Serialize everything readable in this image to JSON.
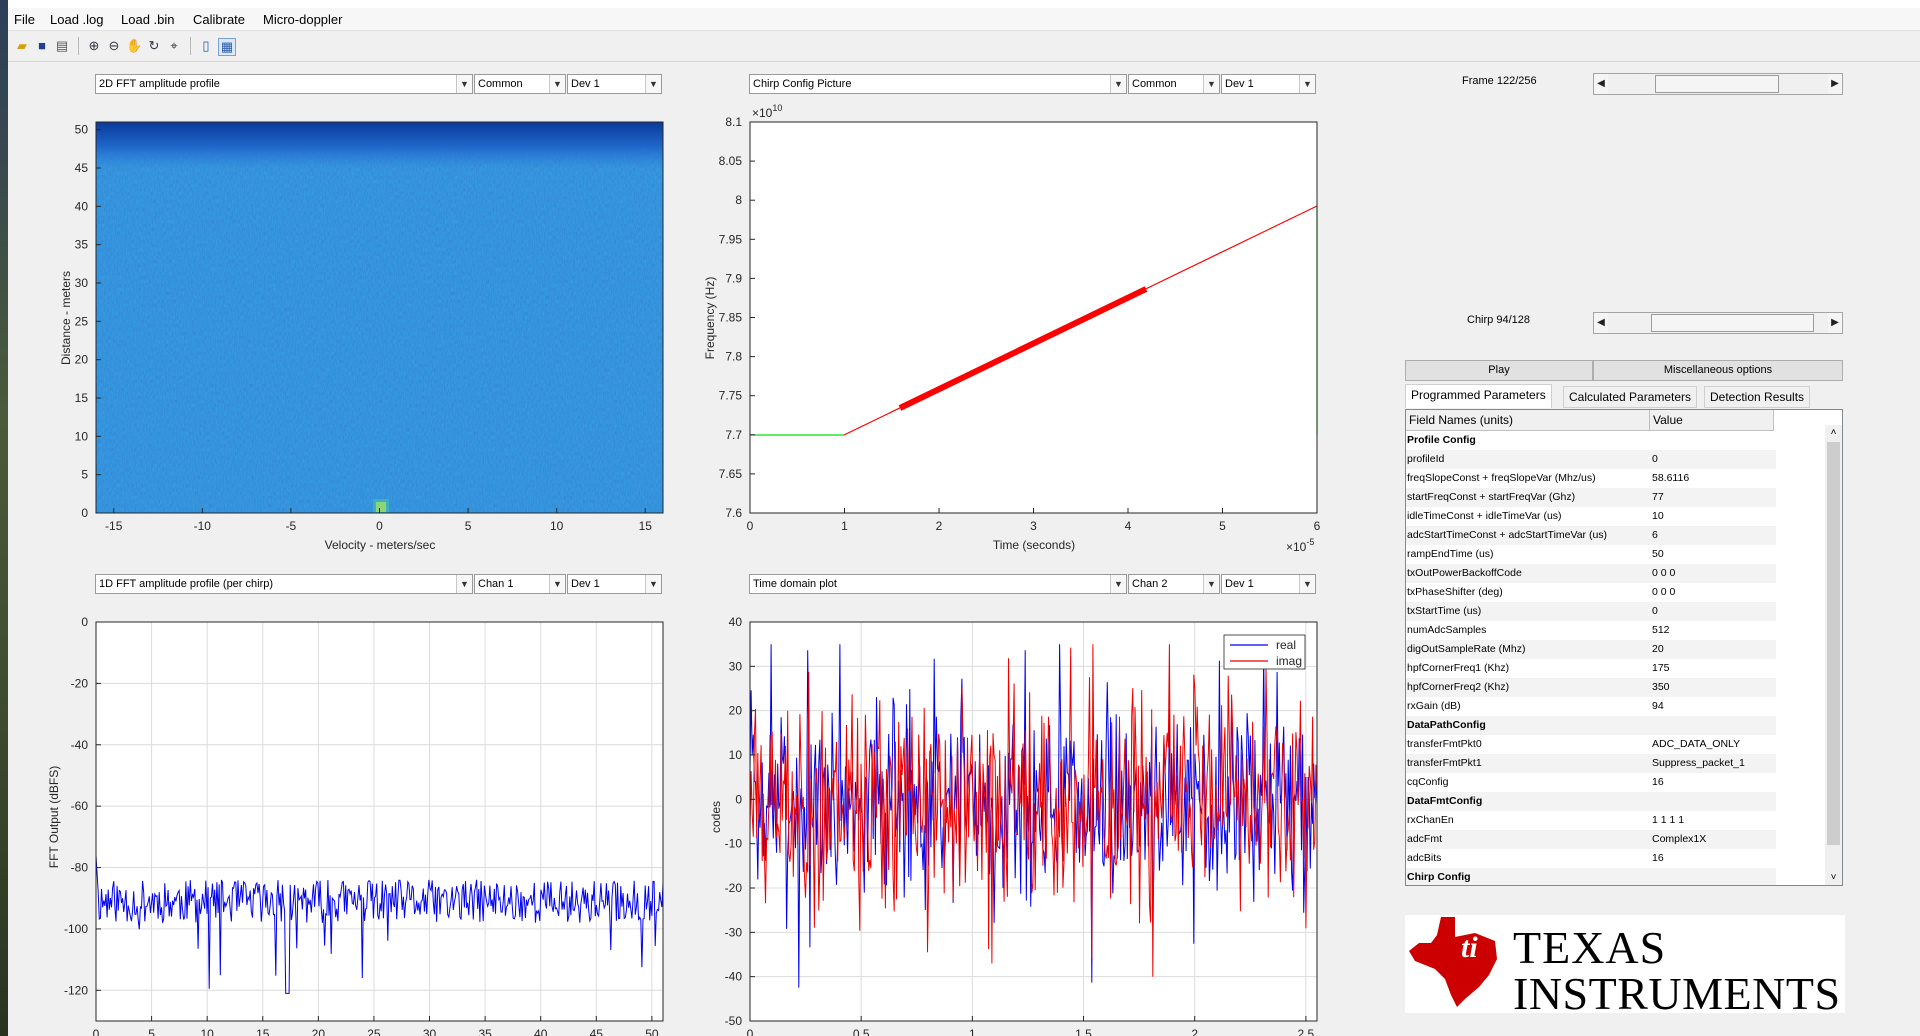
{
  "menu": [
    "File",
    "Load .log",
    "Load .bin",
    "Calibrate",
    "Micro-doppler"
  ],
  "toolbar_icons": [
    "open-folder-icon",
    "save-icon",
    "print-icon",
    "zoom-in-icon",
    "zoom-out-icon",
    "pan-hand-icon",
    "rotate-3d-icon",
    "data-cursor-icon",
    "colorbar-icon",
    "legend-icon"
  ],
  "plots": {
    "p1": {
      "dropdowns": [
        "2D FFT amplitude profile",
        "Common",
        "Dev 1"
      ],
      "xlabel": "Velocity - meters/sec",
      "ylabel": "Distance - meters",
      "xticks": [
        "-15",
        "-10",
        "-5",
        "0",
        "5",
        "10",
        "15"
      ],
      "yticks": [
        "0",
        "5",
        "10",
        "15",
        "20",
        "25",
        "30",
        "35",
        "40",
        "45",
        "50"
      ]
    },
    "p2": {
      "dropdowns": [
        "Chirp Config Picture",
        "Common",
        "Dev 1"
      ],
      "xlabel": "Time (seconds)",
      "ylabel": "Frequency (Hz)",
      "xticks": [
        "0",
        "1",
        "2",
        "3",
        "4",
        "5",
        "6"
      ],
      "yticks": [
        "7.6",
        "7.65",
        "7.7",
        "7.75",
        "7.8",
        "7.85",
        "7.9",
        "7.95",
        "8",
        "8.05",
        "8.1"
      ],
      "y_exponent": "×10",
      "y_exponent_power": "10",
      "x_exponent": "×10",
      "x_exponent_power": "-5"
    },
    "p3": {
      "dropdowns": [
        "1D FFT amplitude profile (per chirp)",
        "Chan 1",
        "Dev 1"
      ],
      "ylabel": "FFT Output (dBFS)",
      "xticks": [
        "0",
        "5",
        "10",
        "15",
        "20",
        "25",
        "30",
        "35",
        "40",
        "45",
        "50"
      ],
      "yticks": [
        "0",
        "-20",
        "-40",
        "-60",
        "-80",
        "-100",
        "-120"
      ]
    },
    "p4": {
      "dropdowns": [
        "Time domain plot",
        "Chan 2",
        "Dev 1"
      ],
      "ylabel": "codes",
      "xticks": [
        "0",
        "0.5",
        "1",
        "1.5",
        "2",
        "2.5"
      ],
      "yticks": [
        "40",
        "30",
        "20",
        "10",
        "0",
        "-10",
        "-20",
        "-30",
        "-40",
        "-50"
      ],
      "legend": [
        "real",
        "imag"
      ]
    }
  },
  "chart_data": [
    {
      "type": "heatmap",
      "title": "",
      "xlabel": "Velocity - meters/sec",
      "ylabel": "Distance - meters",
      "xlim": [
        -16,
        16
      ],
      "ylim": [
        0,
        51
      ],
      "colormap": "parula",
      "dominant_value": "low (blue)",
      "hotspot": {
        "x": 0,
        "y": 0.5
      }
    },
    {
      "type": "line",
      "title": "",
      "xlabel": "Time (seconds)",
      "ylabel": "Frequency (Hz)",
      "xlim": [
        0,
        6e-05
      ],
      "ylim": [
        76000000000.0,
        81000000000.0
      ],
      "series": [
        {
          "name": "",
          "color": "#00ff00",
          "x": [
            0,
            1e-05
          ],
          "y": [
            77000000000.0,
            77000000000.0
          ]
        },
        {
          "name": "",
          "color": "#ff0000",
          "x": [
            1e-05,
            6e-05
          ],
          "y": [
            77000000000.0,
            79930000000.0
          ]
        },
        {
          "name": "",
          "color": "#ff0000",
          "x": [
            1.6e-05,
            4.2e-05
          ],
          "y": [
            77350000000.0,
            78880000000.0
          ]
        },
        {
          "name": "",
          "color": "#00ff00",
          "x": [
            6e-05,
            6e-05
          ],
          "y": [
            79930000000.0,
            77000000000.0
          ]
        }
      ]
    },
    {
      "type": "line",
      "title": "",
      "xlabel": "",
      "ylabel": "FFT Output (dBFS)",
      "xlim": [
        0,
        51
      ],
      "ylim": [
        -130,
        0
      ],
      "series": [
        {
          "name": "",
          "color": "#0000ff",
          "description": "noise floor around -90 dBFS"
        }
      ]
    },
    {
      "type": "line",
      "title": "",
      "xlabel": "",
      "ylabel": "codes",
      "xlim": [
        0,
        2.55
      ],
      "ylim": [
        -50,
        40
      ],
      "series": [
        {
          "name": "real",
          "color": "#0000ff"
        },
        {
          "name": "imag",
          "color": "#ff0000"
        }
      ]
    }
  ],
  "frame_label": "Frame 122/256",
  "chirp_label": "Chirp 94/128",
  "frame_slider_value": 0.477,
  "chirp_slider_value": 0.734,
  "buttons": {
    "play": "Play",
    "misc": "Miscellaneous options"
  },
  "tabs": [
    "Programmed Parameters",
    "Calculated Parameters",
    "Detection Results"
  ],
  "table": {
    "headers": [
      "Field Names    (units)",
      "Value"
    ],
    "rows": [
      {
        "name": "Profile Config",
        "value": "",
        "section": true
      },
      {
        "name": "profileId",
        "value": "0"
      },
      {
        "name": "freqSlopeConst + freqSlopeVar (Mhz/us)",
        "value": "58.6116"
      },
      {
        "name": "startFreqConst + startFreqVar (Ghz)",
        "value": "77"
      },
      {
        "name": "idleTimeConst + idleTimeVar (us)",
        "value": "10"
      },
      {
        "name": "adcStartTimeConst + adcStartTimeVar (us)",
        "value": "6"
      },
      {
        "name": "rampEndTime (us)",
        "value": "50"
      },
      {
        "name": "txOutPowerBackoffCode",
        "value": "0 0 0"
      },
      {
        "name": "txPhaseShifter (deg)",
        "value": "0 0 0"
      },
      {
        "name": "txStartTime (us)",
        "value": "0"
      },
      {
        "name": "numAdcSamples",
        "value": "512"
      },
      {
        "name": "digOutSampleRate (Mhz)",
        "value": "20"
      },
      {
        "name": "hpfCornerFreq1 (Khz)",
        "value": "175"
      },
      {
        "name": "hpfCornerFreq2 (Khz)",
        "value": "350"
      },
      {
        "name": "rxGain (dB)",
        "value": "94"
      },
      {
        "name": "DataPathConfig",
        "value": "",
        "section": true
      },
      {
        "name": "transferFmtPkt0",
        "value": "ADC_DATA_ONLY"
      },
      {
        "name": "transferFmtPkt1",
        "value": "Suppress_packet_1"
      },
      {
        "name": "cqConfig",
        "value": "16"
      },
      {
        "name": "DataFmtConfig",
        "value": "",
        "section": true
      },
      {
        "name": "rxChanEn",
        "value": "1 1 1 1"
      },
      {
        "name": "adcFmt",
        "value": "Complex1X"
      },
      {
        "name": "adcBits",
        "value": "16"
      },
      {
        "name": "Chirp Config",
        "value": "",
        "section": true
      }
    ]
  },
  "logo": {
    "line1": "Texas",
    "line2": "Instruments",
    "color": "#cc0000"
  }
}
